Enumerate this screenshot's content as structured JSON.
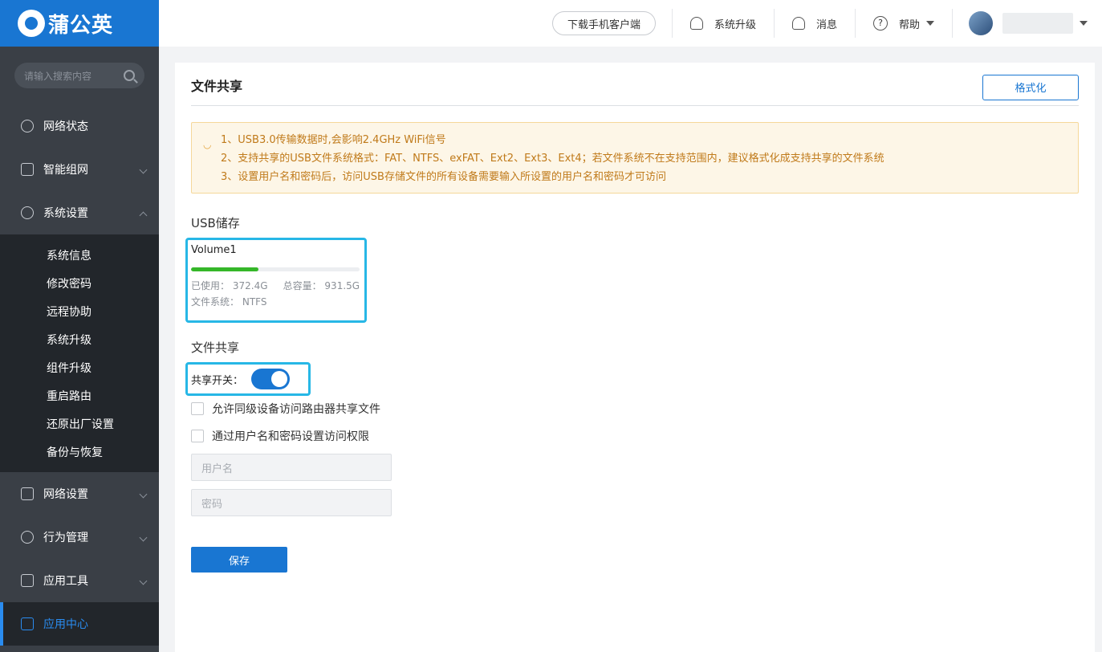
{
  "brand": {
    "name": "蒲公英"
  },
  "sidebar": {
    "search_placeholder": "请输入搜索内容",
    "items": [
      {
        "label": "网络状态",
        "icon": "planet-icon"
      },
      {
        "label": "智能组网",
        "icon": "network-icon"
      },
      {
        "label": "系统设置",
        "icon": "gear-icon"
      },
      {
        "label": "网络设置",
        "icon": "doc-icon"
      },
      {
        "label": "行为管理",
        "icon": "behavior-icon"
      },
      {
        "label": "应用工具",
        "icon": "toolbox-icon"
      },
      {
        "label": "应用中心",
        "icon": "cube-icon"
      }
    ],
    "sub_items": [
      "系统信息",
      "修改密码",
      "远程协助",
      "系统升级",
      "组件升级",
      "重启路由",
      "还原出厂设置",
      "备份与恢复"
    ]
  },
  "topbar": {
    "download": "下载手机客户端",
    "upgrade": "系统升级",
    "messages": "消息",
    "help": "帮助"
  },
  "panel": {
    "title": "文件共享",
    "format_button": "格式化",
    "notice": [
      "1、USB3.0传输数据时,会影响2.4GHz WiFi信号",
      "2、支持共享的USB文件系统格式：FAT、NTFS、exFAT、Ext2、Ext3、Ext4；若文件系统不在支持范围内，建议格式化成支持共享的文件系统",
      "3、设置用户名和密码后，访问USB存储文件的所有设备需要输入所设置的用户名和密码才可访问"
    ],
    "usb_section": "USB储存",
    "volume": {
      "name": "Volume1",
      "used_label": "已使用：",
      "used": "372.4G",
      "total_label": "总容量：",
      "total": "931.5G",
      "fs_label": "文件系统：",
      "fs": "NTFS",
      "used_fraction": 0.4
    },
    "share_section": "文件共享",
    "share_switch_label": "共享开关：",
    "share_switch_on": true,
    "checkbox_same_level": "允许同级设备访问路由器共享文件",
    "checkbox_auth": "通过用户名和密码设置访问权限",
    "username_placeholder": "用户名",
    "password_placeholder": "密码",
    "save_button": "保存"
  },
  "colors": {
    "primary": "#1976d2",
    "sidebar": "#3a3f46",
    "progress": "#35b729",
    "highlight": "#27b7e6",
    "notice_text": "#c07a1a"
  }
}
